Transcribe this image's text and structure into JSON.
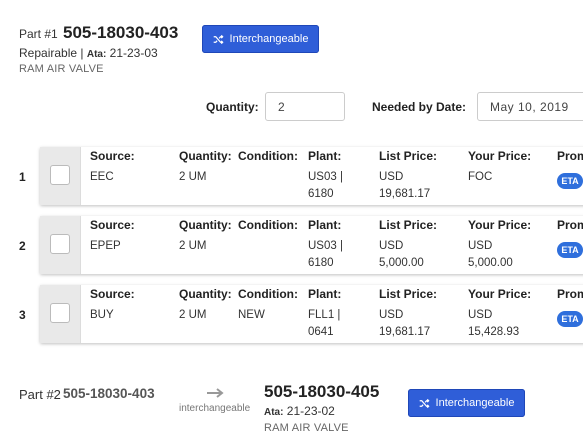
{
  "part1": {
    "prefix": "Part #1",
    "number": "505-18030-403",
    "status": "Repairable",
    "ata_label": "Ata:",
    "ata_value": "21-23-03",
    "description": "RAM AIR VALVE",
    "button_label": "Interchangeable"
  },
  "order": {
    "quantity_label": "Quantity:",
    "quantity_value": "2",
    "date_label": "Needed by Date:",
    "date_value": "May 10, 2019"
  },
  "headers": {
    "source": "Source:",
    "quantity": "Quantity:",
    "condition": "Condition:",
    "plant": "Plant:",
    "list_price": "List Price:",
    "your_price": "Your Price:",
    "promise": "Prom"
  },
  "rows": [
    {
      "index": "1",
      "source": "EEC",
      "quantity": "2 UM",
      "condition": "",
      "plant1": "US03 |",
      "plant2": "6180",
      "list1": "USD",
      "list2": "19,681.17",
      "your1": "FOC",
      "your2": "",
      "badge": "ETA"
    },
    {
      "index": "2",
      "source": "EPEP",
      "quantity": "2 UM",
      "condition": "",
      "plant1": "US03 |",
      "plant2": "6180",
      "list1": "USD",
      "list2": "5,000.00",
      "your1": "USD",
      "your2": "5,000.00",
      "badge": "ETA"
    },
    {
      "index": "3",
      "source": "BUY",
      "quantity": "2 UM",
      "condition": "NEW",
      "plant1": "FLL1 |",
      "plant2": "0641",
      "list1": "USD",
      "list2": "19,681.17",
      "your1": "USD",
      "your2": "15,428.93",
      "badge": "ETA"
    }
  ],
  "part2": {
    "prefix": "Part #2",
    "number": "505-18030-403",
    "arrow_caption": "interchangeable",
    "alt_number": "505-18030-405",
    "ata_label": "Ata:",
    "ata_value": "21-23-02",
    "description": "RAM AIR VALVE",
    "button_label": "Interchangeable"
  },
  "colors": {
    "accent": "#2f5ed8",
    "badge": "#2f6fdc"
  },
  "icons": {
    "button": "shuffle-icon",
    "arrow": "arrow-right-icon"
  }
}
